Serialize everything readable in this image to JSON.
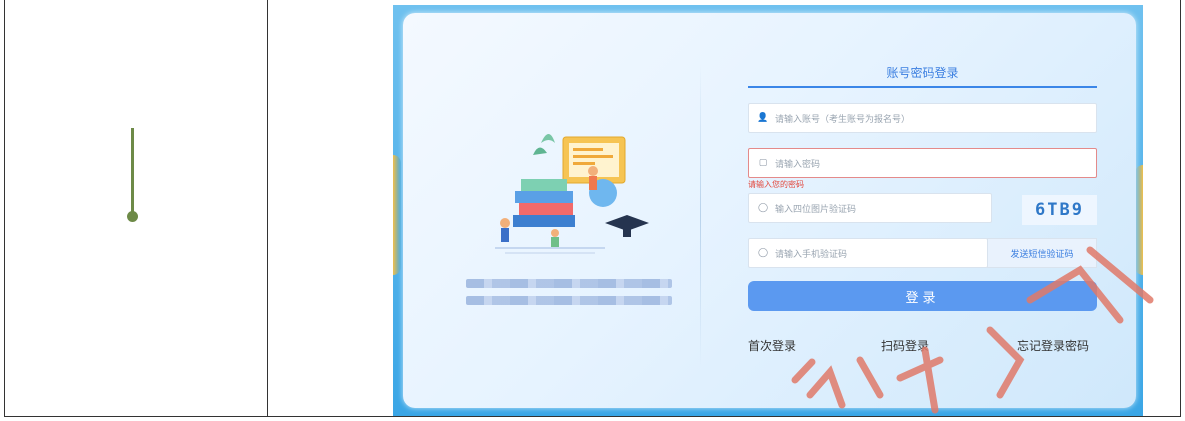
{
  "login": {
    "tab_title": "账号密码登录",
    "account_placeholder": "请输入账号（考生账号为报名号）",
    "password_placeholder": "请输入密码",
    "password_error": "请输入您的密码",
    "captcha_placeholder": "输入四位图片验证码",
    "captcha_code": "6TB9",
    "sms_placeholder": "请输入手机验证码",
    "send_sms_label": "发送短信验证码",
    "login_button": "登录",
    "first_login": "首次登录",
    "scan_login": "扫码登录",
    "forgot_password": "忘记登录密码"
  },
  "icons": {
    "account": "user-icon",
    "password": "lock-icon",
    "captcha": "shield-icon",
    "sms": "shield-icon"
  },
  "colors": {
    "accent": "#3b86e8",
    "button": "#5b99f0",
    "error": "#e2463b",
    "watermark": "#e07a6a",
    "pin": "#6d8a47"
  }
}
